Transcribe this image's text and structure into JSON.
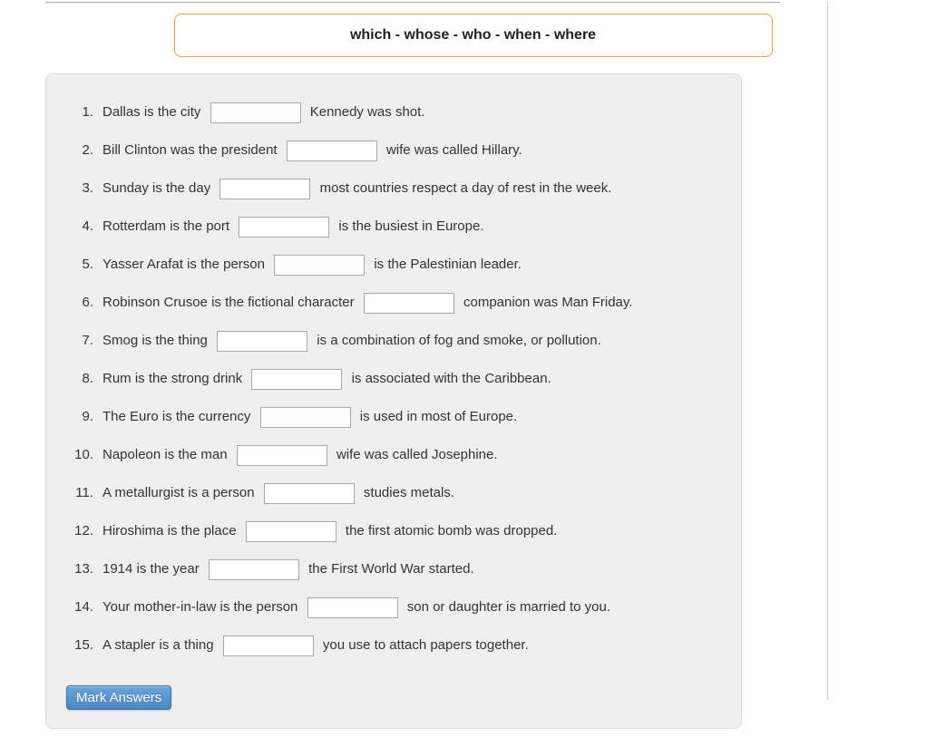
{
  "word_bank": "which - whose - who - when - where",
  "questions": [
    {
      "num": "1.",
      "before": "Dallas is the city",
      "after": "Kennedy was shot."
    },
    {
      "num": "2.",
      "before": "Bill Clinton was the president",
      "after": "wife was called Hillary."
    },
    {
      "num": "3.",
      "before": "Sunday is the day",
      "after": "most countries respect a day of rest in the week."
    },
    {
      "num": "4.",
      "before": "Rotterdam is the port",
      "after": "is the busiest in Europe."
    },
    {
      "num": "5.",
      "before": "Yasser Arafat is the person",
      "after": "is the Palestinian leader."
    },
    {
      "num": "6.",
      "before": "Robinson Crusoe is the fictional character",
      "after": "companion was Man Friday."
    },
    {
      "num": "7.",
      "before": "Smog is the thing",
      "after": "is a combination of fog and smoke, or pollution."
    },
    {
      "num": "8.",
      "before": "Rum is the strong drink",
      "after": "is associated with the Caribbean."
    },
    {
      "num": "9.",
      "before": "The Euro is the currency",
      "after": "is used in most of Europe."
    },
    {
      "num": "10.",
      "before": "Napoleon is the man",
      "after": "wife was called Josephine."
    },
    {
      "num": "11.",
      "before": "A metallurgist is a person",
      "after": "studies metals."
    },
    {
      "num": "12.",
      "before": "Hiroshima is the place",
      "after": "the first atomic bomb was dropped."
    },
    {
      "num": "13.",
      "before": "1914 is the year",
      "after": "the First World War started."
    },
    {
      "num": "14.",
      "before": "Your mother-in-law is the person",
      "after": "son or daughter is married to you."
    },
    {
      "num": "15.",
      "before": "A stapler is a thing",
      "after": "you use to attach papers together."
    }
  ],
  "button": {
    "mark": "Mark Answers"
  }
}
